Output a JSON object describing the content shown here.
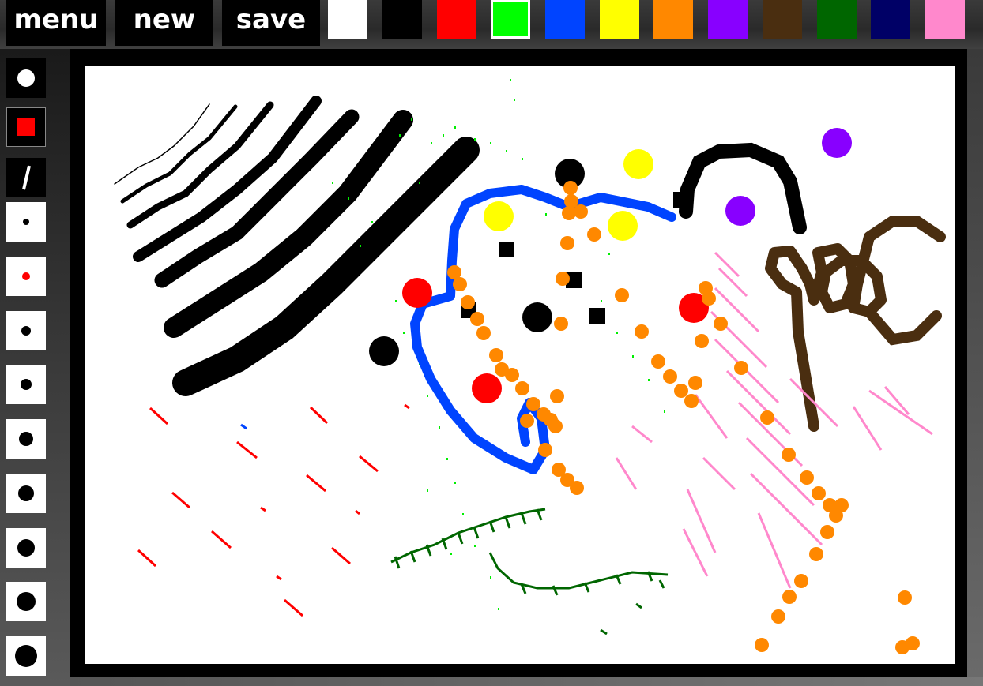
{
  "toolbar": {
    "menu_label": "menu",
    "new_label": "new",
    "save_label": "save"
  },
  "palette": {
    "selected": "#00ff00",
    "colors": [
      "#ffffff",
      "#000000",
      "#ff0000",
      "#00ff00",
      "#0044ff",
      "#ffff00",
      "#ff8800",
      "#8800ff",
      "#4a2e10",
      "#006600",
      "#000066",
      "#ff88cc"
    ]
  },
  "tools": {
    "shapes": [
      "circle-tool",
      "square-tool",
      "line-tool"
    ],
    "active_shape": "square-tool",
    "brush_sizes": 9,
    "active_color": "#ff0000"
  }
}
